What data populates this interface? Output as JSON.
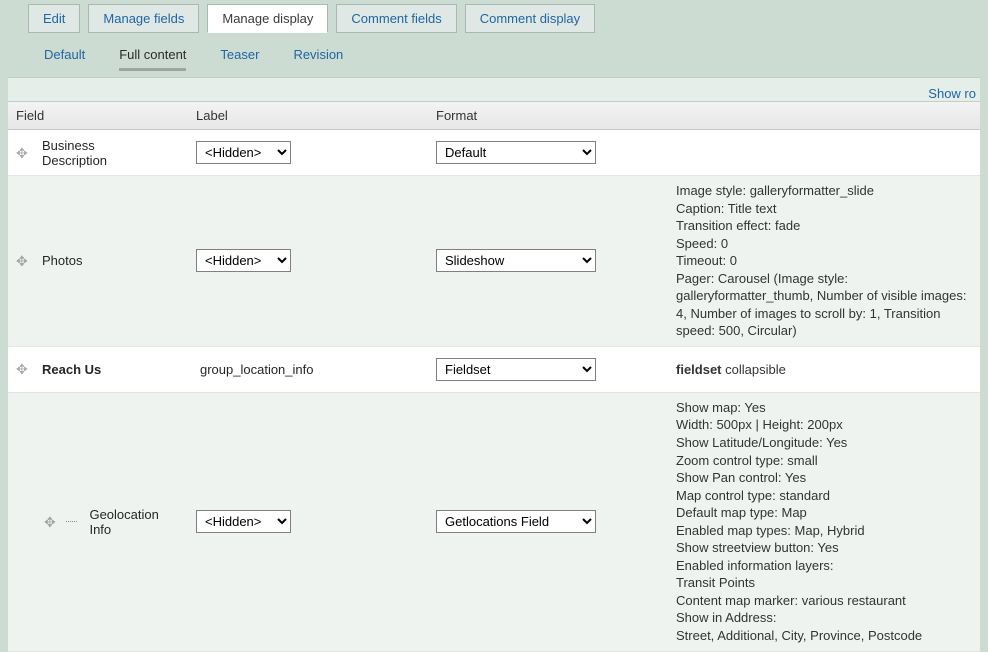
{
  "primaryTabs": {
    "edit": "Edit",
    "manageFields": "Manage fields",
    "manageDisplay": "Manage display",
    "commentFields": "Comment fields",
    "commentDisplay": "Comment display"
  },
  "secondaryTabs": {
    "default": "Default",
    "fullContent": "Full content",
    "teaser": "Teaser",
    "revision": "Revision"
  },
  "showRowLink": "Show ro",
  "columns": {
    "field": "Field",
    "label": "Label",
    "format": "Format"
  },
  "labelOptions": {
    "hidden": "<Hidden>"
  },
  "rows": {
    "bizdesc": {
      "name": "Business Description",
      "label": "<Hidden>",
      "format": "Default"
    },
    "photos": {
      "name": "Photos",
      "label": "<Hidden>",
      "format": "Slideshow",
      "summary": "Image style: galleryformatter_slide\nCaption: Title text\nTransition effect: fade\nSpeed: 0\nTimeout: 0\nPager: Carousel (Image style: galleryformatter_thumb, Number of visible images: 4, Number of images to scroll by: 1, Transition speed: 500, Circular)"
    },
    "reachus": {
      "name": "Reach Us",
      "labelText": "group_location_info",
      "format": "Fieldset",
      "summaryBold": "fieldset",
      "summaryRest": " collapsible"
    },
    "geo": {
      "name": "Geolocation Info",
      "label": "<Hidden>",
      "format": "Getlocations Field",
      "summary": "Show map: Yes\nWidth: 500px | Height: 200px\nShow Latitude/Longitude: Yes\nZoom control type: small\nShow Pan control: Yes\nMap control type: standard\nDefault map type: Map\nEnabled map types: Map, Hybrid\nShow streetview button: Yes\nEnabled information layers:\nTransit Points\nContent map marker: various restaurant\nShow in Address:\nStreet, Additional, City, Province, Postcode"
    }
  }
}
